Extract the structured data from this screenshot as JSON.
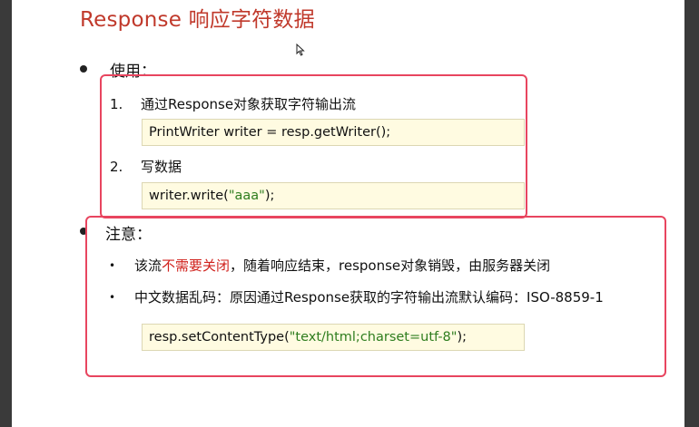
{
  "slide": {
    "title": "Response 响应字符数据",
    "usage": {
      "heading": "使用：",
      "step1": {
        "num": "1.",
        "text": "通过Response对象获取字符输出流"
      },
      "code1": "PrintWriter writer = resp.getWriter();",
      "step2": {
        "num": "2.",
        "text": "写数据"
      },
      "code2": {
        "pre": "writer.write(",
        "str": "\"aaa\"",
        "post": ");"
      }
    },
    "notes": {
      "heading": "注意：",
      "item1": {
        "pre": "该流",
        "highlight": "不需要关闭",
        "post": "，随着响应结束，response对象销毁，由服务器关闭"
      },
      "item2": "中文数据乱码：原因通过Response获取的字符输出流默认编码：ISO-8859-1",
      "code3": {
        "pre": "resp.setContentType(",
        "str": "\"text/html;charset=utf-8\"",
        "post": ");"
      }
    },
    "bullet_char": "•"
  },
  "colors": {
    "title": "#c0392b",
    "highlight_border": "#e8455f",
    "code_bg": "#fffbe1",
    "string": "#2e7d1e",
    "warning": "#d0211c"
  }
}
